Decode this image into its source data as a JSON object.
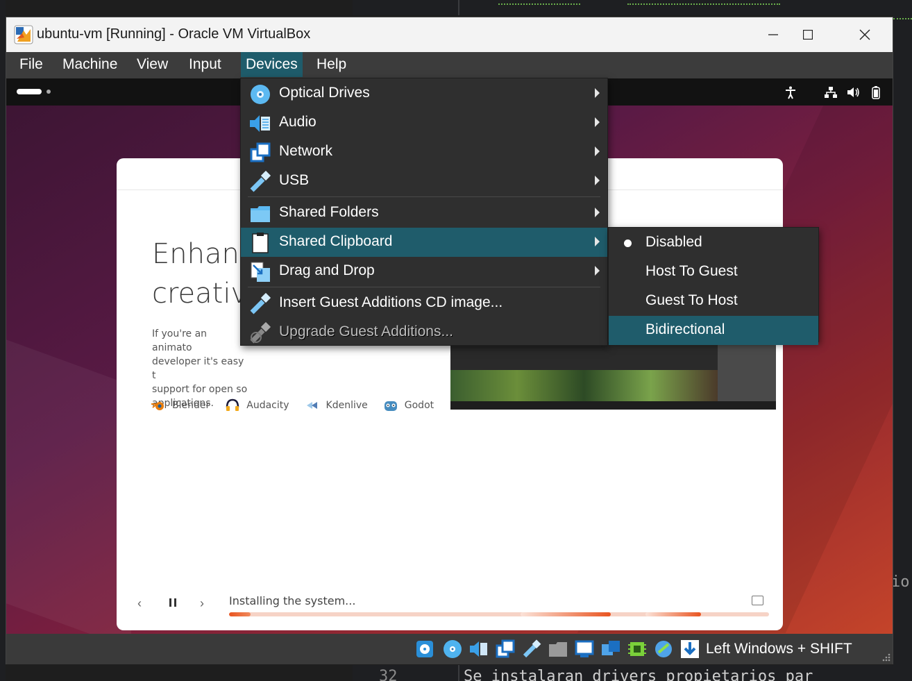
{
  "window": {
    "title": "ubuntu-vm [Running] - Oracle VM VirtualBox",
    "minimize_glyph": "—",
    "maximize_glyph": "☐",
    "close_glyph": "✕"
  },
  "menubar": {
    "items": [
      {
        "label": "File"
      },
      {
        "label": "Machine"
      },
      {
        "label": "View"
      },
      {
        "label": "Input"
      },
      {
        "label": "Devices"
      },
      {
        "label": "Help"
      }
    ],
    "active": "Devices"
  },
  "devices_menu": {
    "items": [
      {
        "label": "Optical Drives",
        "icon": "optical-drive-icon"
      },
      {
        "label": "Audio",
        "icon": "audio-icon"
      },
      {
        "label": "Network",
        "icon": "network-icon"
      },
      {
        "label": "USB",
        "icon": "usb-icon"
      },
      {
        "label": "Shared Folders",
        "icon": "shared-folders-icon"
      },
      {
        "label": "Shared Clipboard",
        "icon": "shared-clipboard-icon"
      },
      {
        "label": "Drag and Drop",
        "icon": "drag-and-drop-icon"
      },
      {
        "label": "Insert Guest Additions CD image...",
        "icon": "insert-cd-icon"
      },
      {
        "label": "Upgrade Guest Additions...",
        "icon": "upgrade-icon"
      }
    ],
    "highlighted": "Shared Clipboard"
  },
  "clipboard_submenu": {
    "items": [
      {
        "label": "Disabled",
        "checked": true
      },
      {
        "label": "Host To Guest",
        "checked": false
      },
      {
        "label": "Guest To Host",
        "checked": false
      },
      {
        "label": "Bidirectional",
        "checked": false
      }
    ],
    "highlighted": "Bidirectional"
  },
  "installer": {
    "title_line1": "Enhanc",
    "title_line2": "creativi",
    "body_lines": [
      "If you're an animato",
      "developer it's easy t",
      "support for open so",
      "applications."
    ],
    "apps": [
      {
        "name": "Blender",
        "icon": "blender-icon"
      },
      {
        "name": "Audacity",
        "icon": "audacity-icon"
      },
      {
        "name": "Kdenlive",
        "icon": "kdenlive-icon"
      },
      {
        "name": "Godot",
        "icon": "godot-icon"
      }
    ],
    "status": "Installing the system...",
    "progress": 0.04,
    "prev_glyph": "‹",
    "next_glyph": "›"
  },
  "statusbar": {
    "host_key": "Left Windows + SHIFT",
    "icons": [
      "hard-disk-icon",
      "optical-drive-icon",
      "audio-icon",
      "network-icon",
      "usb-icon",
      "shared-folders-icon",
      "display-icon",
      "recording-icon",
      "cpu-icon",
      "mouse-integration-icon",
      "download-icon"
    ]
  },
  "background": {
    "line_number": "32",
    "code_text": "Se instalaran drivers propietarios par",
    "side_text": "io"
  },
  "colors": {
    "highlight": "#1f5c6b",
    "menu_bg": "#2f2f2f",
    "ubuntu_orange": "#e95420"
  }
}
